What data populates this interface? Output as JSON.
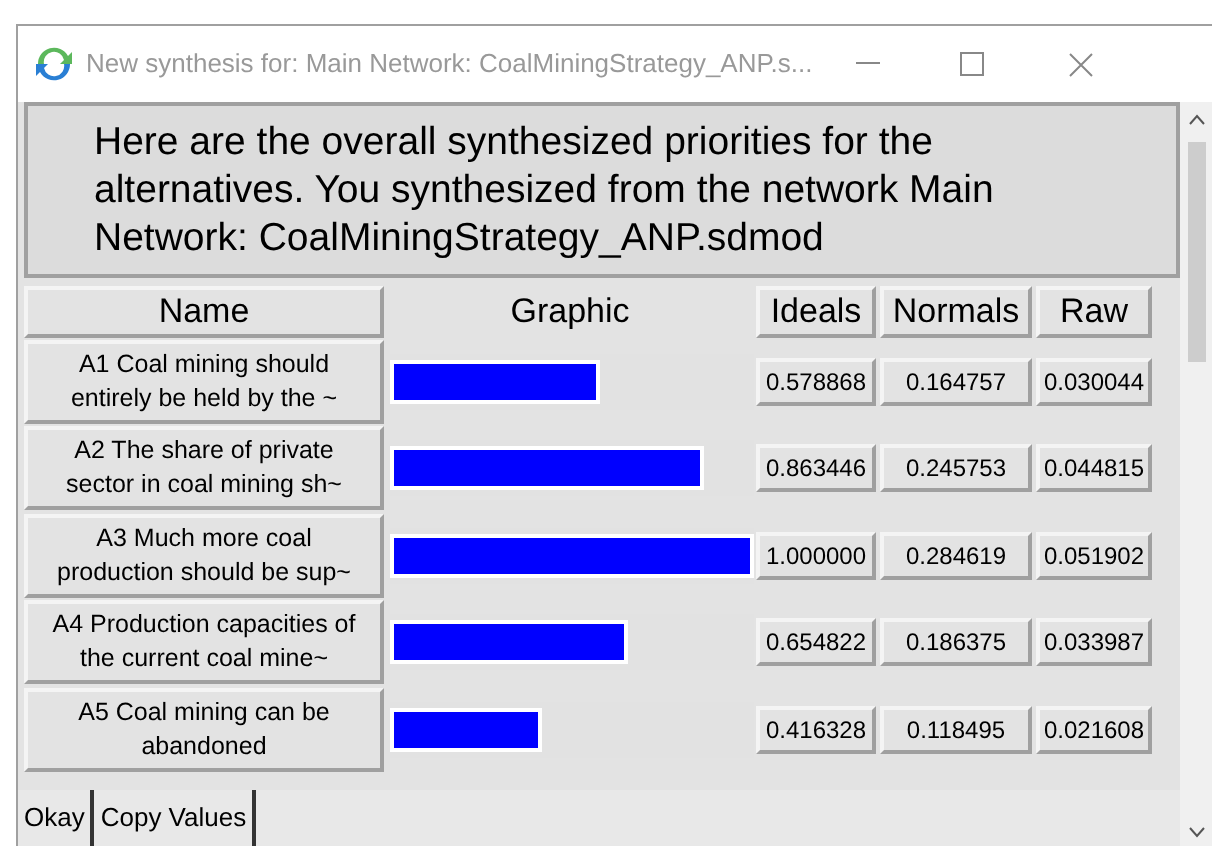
{
  "window": {
    "title": "New synthesis for: Main Network: CoalMiningStrategy_ANP.s..."
  },
  "message": "Here are the overall synthesized priorities for the alternatives.  You synthesized from the network Main Network: CoalMiningStrategy_ANP.sdmod",
  "table": {
    "columns": [
      "Name",
      "Graphic",
      "Ideals",
      "Normals",
      "Raw"
    ],
    "rows": [
      {
        "name": "A1 Coal mining should entirely be held by the ~",
        "level": 0.578868,
        "ideals": "0.578868",
        "normals": "0.164757",
        "raw": "0.030044"
      },
      {
        "name": "A2 The share of private sector in coal mining sh~",
        "level": 0.863446,
        "ideals": "0.863446",
        "normals": "0.245753",
        "raw": "0.044815"
      },
      {
        "name": "A3 Much more coal production should be sup~",
        "level": 1.0,
        "ideals": "1.000000",
        "normals": "0.284619",
        "raw": "0.051902"
      },
      {
        "name": "A4 Production capacities of the current coal mine~",
        "level": 0.654822,
        "ideals": "0.654822",
        "normals": "0.186375",
        "raw": "0.033987"
      },
      {
        "name": "A5 Coal mining can be abandoned",
        "level": 0.416328,
        "ideals": "0.416328",
        "normals": "0.118495",
        "raw": "0.021608"
      }
    ]
  },
  "buttons": [
    "Okay",
    "Copy Values"
  ]
}
